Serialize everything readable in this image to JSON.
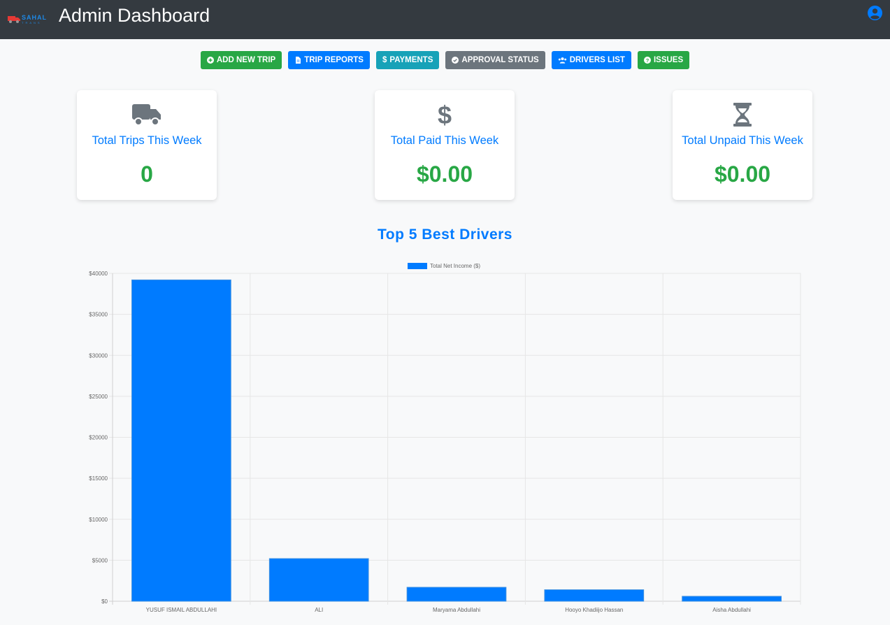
{
  "header": {
    "logo_text": "SAHAL",
    "logo_sub": "TRANS",
    "title": "Admin Dashboard",
    "user_icon": "user-circle-icon"
  },
  "actions": [
    {
      "label": "ADD NEW TRIP",
      "icon": "plus-circle-icon",
      "color": "#28a745"
    },
    {
      "label": "TRIP REPORTS",
      "icon": "file-icon",
      "color": "#007bff"
    },
    {
      "label": "PAYMENTS",
      "icon": "dollar-icon",
      "color": "#17a2b8"
    },
    {
      "label": "APPROVAL STATUS",
      "icon": "check-circle-icon",
      "color": "#6c757d"
    },
    {
      "label": "DRIVERS LIST",
      "icon": "users-icon",
      "color": "#007bff"
    },
    {
      "label": "ISSUES",
      "icon": "question-circle-icon",
      "color": "#28a745"
    }
  ],
  "stats": [
    {
      "label": "Total Trips This Week",
      "value": "0",
      "icon": "truck-icon"
    },
    {
      "label": "Total Paid This Week",
      "value": "$0.00",
      "icon": "dollar-icon"
    },
    {
      "label": "Total Unpaid This Week",
      "value": "$0.00",
      "icon": "hourglass-icon"
    }
  ],
  "chart_title": "Top 5 Best Drivers",
  "chart_data": {
    "type": "bar",
    "categories": [
      "YUSUF ISMAIL ABDULLAHI",
      "ALI",
      "Maryama Abdullahi",
      "Hooyo Khadiijo Hassan",
      "Aisha Abdullahi"
    ],
    "series": [
      {
        "name": "Total Net Income ($)",
        "values": [
          39200,
          5200,
          1700,
          1400,
          600
        ],
        "color": "#007bff"
      }
    ],
    "yticks": [
      "$0",
      "$5000",
      "$10000",
      "$15000",
      "$20000",
      "$25000",
      "$30000",
      "$35000",
      "$40000"
    ],
    "ylim": [
      0,
      40000
    ],
    "grid": true,
    "legend": "top-center"
  }
}
